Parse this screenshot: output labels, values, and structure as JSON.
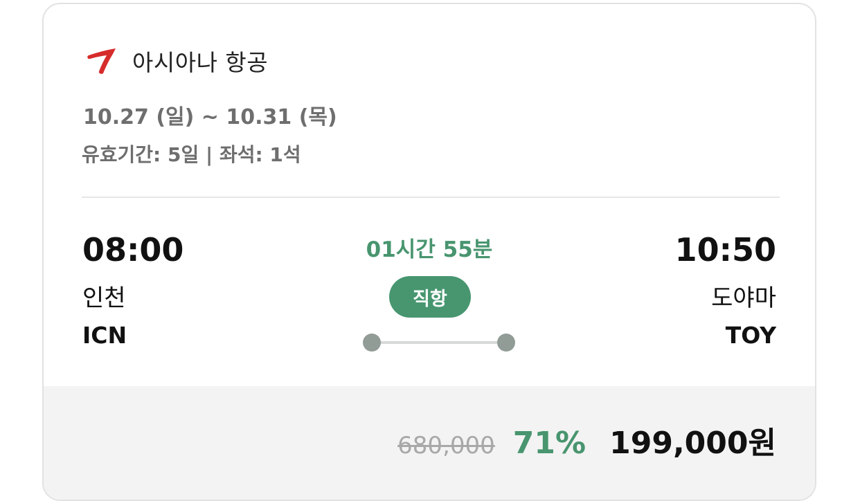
{
  "airline": {
    "name": "아시아나 항공",
    "logo_icon": "asiana-wing-logo",
    "logo_color": "#d62c2c"
  },
  "trip": {
    "dates": "10.27 (일) ~ 10.31 (목)",
    "validity": "유효기간: 5일 | 좌석: 1석"
  },
  "departure": {
    "time": "08:00",
    "city": "인천",
    "code": "ICN"
  },
  "arrival": {
    "time": "10:50",
    "city": "도야마",
    "code": "TOY"
  },
  "flight": {
    "duration": "01시간 55분",
    "type_badge": "직항"
  },
  "price": {
    "original": "680,000",
    "discount": "71%",
    "final": "199,000원"
  },
  "colors": {
    "accent_green": "#48956f",
    "badge_green": "#479670",
    "route_dot": "#929c97",
    "price_bg": "#f3f3f3"
  }
}
